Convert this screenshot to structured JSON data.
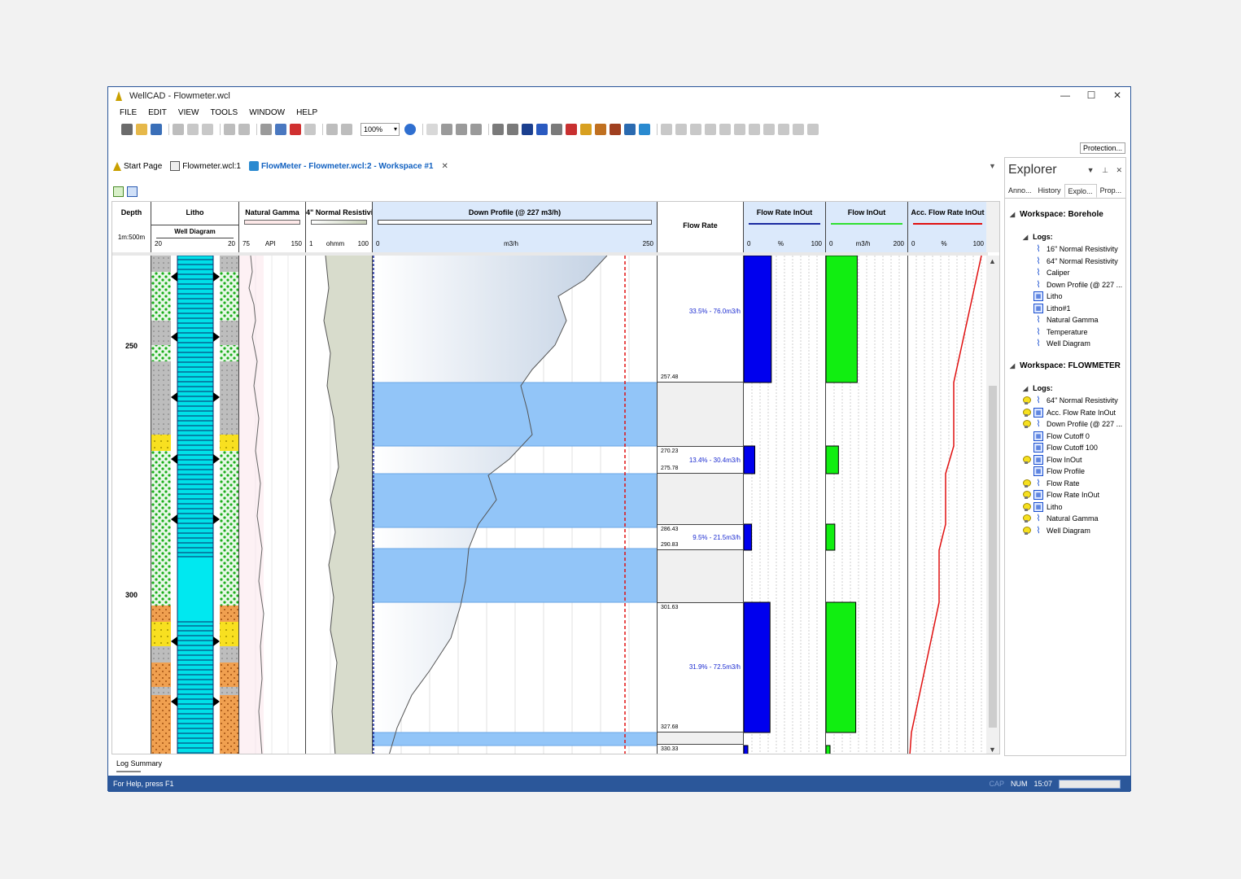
{
  "window": {
    "title": "WellCAD - Flowmeter.wcl",
    "controls": [
      "—",
      "☐",
      "✕"
    ]
  },
  "menu": [
    "FILE",
    "EDIT",
    "VIEW",
    "TOOLS",
    "WINDOW",
    "HELP"
  ],
  "toolbar": {
    "zoom": "100%",
    "protection_label": "Protection..."
  },
  "doc_tabs": [
    {
      "label": "Start Page"
    },
    {
      "label": "Flowmeter.wcl:1"
    },
    {
      "label": "FlowMeter - Flowmeter.wcl:2 - Workspace #1",
      "active": true
    }
  ],
  "headers": {
    "depth": {
      "title": "Depth",
      "scale": "1m:500m"
    },
    "litho": {
      "title": "Litho",
      "sub": "Well Diagram",
      "min": "20",
      "max": "20"
    },
    "gamma": {
      "title": "Natural Gamma",
      "min": "75",
      "unit": "API",
      "max": "150"
    },
    "resist": {
      "title": "4\" Normal Resistivi",
      "min": "1",
      "unit": "ohmm",
      "max": "100"
    },
    "profile": {
      "title": "Down Profile (@ 227 m3/h)",
      "min": "0",
      "unit": "m3/h",
      "max": "250"
    },
    "flowrate": {
      "title": "Flow Rate"
    },
    "flowinout_pct": {
      "title": "Flow Rate InOut",
      "min": "0",
      "unit": "%",
      "max": "100"
    },
    "flowinout": {
      "title": "Flow InOut",
      "min": "0",
      "unit": "m3/h",
      "max": "200"
    },
    "accflow": {
      "title": "Acc. Flow Rate InOut",
      "min": "0",
      "unit": "%",
      "max": "100"
    }
  },
  "depth_labels": [
    "250",
    "300"
  ],
  "flow_zones": [
    {
      "label": "33.5% - 76.0m3/h",
      "top": "",
      "bottom": "257.48"
    },
    {
      "label": "13.4% - 30.4m3/h",
      "top": "270.23",
      "bottom": "275.78"
    },
    {
      "label": "9.5% - 21.5m3/h",
      "top": "286.43",
      "bottom": "290.83"
    },
    {
      "label": "31.9% - 72.5m3/h",
      "top": "301.63",
      "bottom": "327.68"
    },
    {
      "label": "",
      "top": "330.33",
      "bottom": ""
    }
  ],
  "flow_inout_pct": [
    33.5,
    13.4,
    9.5,
    31.9
  ],
  "flow_inout_abs": [
    76.0,
    30.4,
    21.5,
    72.5
  ],
  "explorer": {
    "title": "Explorer",
    "tabs": [
      "Anno...",
      "History",
      "Explo...",
      "Prop..."
    ],
    "ws1": "Workspace: Borehole",
    "logs_label": "Logs:",
    "ws1_logs": [
      "16\" Normal Resistivity",
      "64\" Normal Resistivity",
      "Caliper",
      "Down Profile (@ 227 ...",
      "Litho",
      "Litho#1",
      "Natural Gamma",
      "Temperature",
      "Well Diagram"
    ],
    "ws2": "Workspace: FLOWMETER",
    "ws2_logs": [
      "64\" Normal Resistivity",
      "Acc. Flow Rate InOut",
      "Down Profile (@ 227 ...",
      "Flow Cutoff 0",
      "Flow Cutoff 100",
      "Flow InOut",
      "Flow Profile",
      "Flow Rate",
      "Flow Rate InOut",
      "Litho",
      "Natural Gamma",
      "Well Diagram"
    ]
  },
  "log_summary": "Log Summary",
  "status": {
    "help": "For Help, press F1",
    "cap": "CAP",
    "num": "NUM",
    "time": "15:07"
  },
  "colors": {
    "accent": "#2b579a",
    "zone": "#90c4f8",
    "flow_pct": "#0000ee",
    "flow_abs": "#11ee11",
    "acc_line": "#ee1111"
  }
}
